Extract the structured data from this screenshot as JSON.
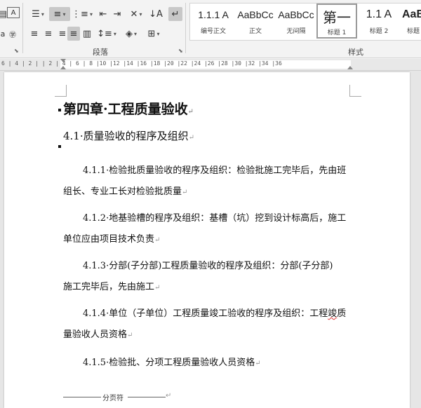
{
  "ribbon": {
    "group_paragraph": "段落",
    "group_styles": "样式",
    "styles": [
      {
        "preview": "1.1.1 A",
        "name": "编号正文"
      },
      {
        "preview": "AaBbCc",
        "name": "正文"
      },
      {
        "preview": "AaBbCc",
        "name": "无间隔"
      },
      {
        "preview": "第一",
        "name": "标题 1"
      },
      {
        "preview": "1.1 A",
        "name": "标题 2"
      },
      {
        "preview": "AaB",
        "name": "标题"
      }
    ]
  },
  "ruler": {
    "text": "6 | 4 | 2 |   | 2 | 4 | 6 | 8 |10 |12 |14 |16 |18 |20 |22 |24 |26 |28 |30 |32 |34 |36"
  },
  "document": {
    "chapter_title": "第四章·工程质量验收",
    "section_title": "4.1·质量验收的程序及组织",
    "paragraphs": [
      {
        "line1": "4.1.1·检验批质量验收的程序及组织：检验批施工完毕后，先由班",
        "line2": "组长、专业工长对检验批质量"
      },
      {
        "line1": "4.1.2·地基验槽的程序及组织：基槽（坑）挖到设计标高后，施工",
        "line2": "单位应由项目技术负责"
      },
      {
        "line1": "4.1.3·分部(子分部)工程质量验收的程序及组织：分部(子分部)",
        "line2": "施工完毕后，先由施工"
      },
      {
        "line1_a": "4.1.4·单位（子单位）工程质量竣工验收的程序及组织：工程",
        "line1_b": "竣",
        "line1_c": "质",
        "line2": "量验收人员资格"
      },
      {
        "line1": "4.1.5·检验批、分项工程质量验收人员资格"
      }
    ],
    "page_break_label": "分页符",
    "para_mark": "↵"
  }
}
